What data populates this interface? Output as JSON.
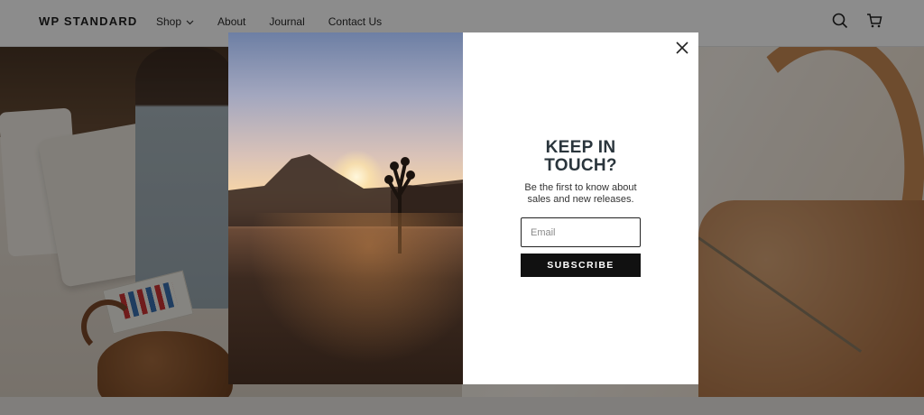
{
  "header": {
    "logo": "WP STANDARD",
    "nav": [
      {
        "label": "Shop",
        "has_dropdown": true
      },
      {
        "label": "About"
      },
      {
        "label": "Journal"
      },
      {
        "label": "Contact Us"
      }
    ],
    "icons": [
      "search-icon",
      "cart-icon"
    ]
  },
  "popup": {
    "title_line1": "KEEP IN",
    "title_line2": "TOUCH?",
    "subtitle_line1": "Be the first to know about",
    "subtitle_line2": "sales and new releases.",
    "email_placeholder": "Email",
    "email_value": "",
    "button_label": "SUBSCRIBE",
    "close_icon": "close-icon"
  },
  "colors": {
    "overlay": "rgba(0,0,0,0.45)",
    "button_bg": "#111111",
    "title": "#2a353c"
  }
}
